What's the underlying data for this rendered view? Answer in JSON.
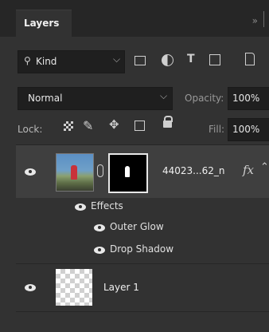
{
  "panel": {
    "tab_label": "Layers",
    "collapse_glyph": "»"
  },
  "filter": {
    "kind_label": "Kind",
    "dropdown_glyph": "⌵"
  },
  "blend": {
    "mode": "Normal",
    "opacity_label": "Opacity:",
    "opacity_value": "100%"
  },
  "lock": {
    "label": "Lock:",
    "fill_label": "Fill:",
    "fill_value": "100%"
  },
  "layers": {
    "main": {
      "name": "44023...62_n",
      "fx_label": "fx"
    },
    "effects_label": "Effects",
    "effects": [
      "Outer Glow",
      "Drop Shadow"
    ],
    "layer1": {
      "name": "Layer 1"
    }
  },
  "colors": {
    "accent": "#262626",
    "selected_row": "#3f3f3f"
  }
}
